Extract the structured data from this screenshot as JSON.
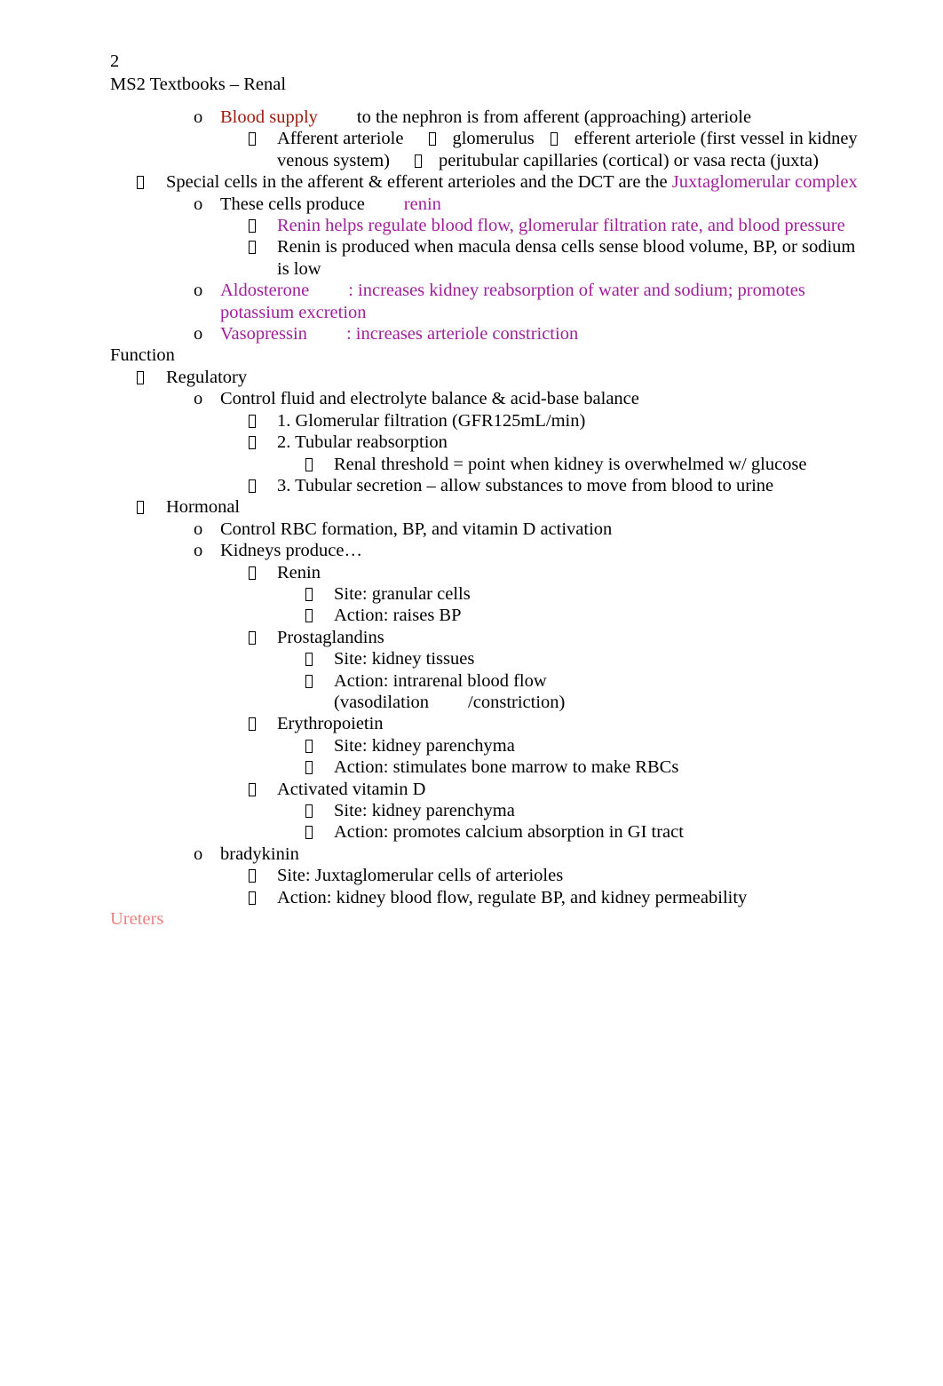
{
  "header": {
    "page_number": "2",
    "title": "MS2 Textbooks – Renal"
  },
  "colors": {
    "heading_red": "#9C1A10",
    "purple": "#A0209B",
    "salmon": "#F08080",
    "black": "#000000"
  },
  "markers": {
    "circle": "o",
    "box": "□"
  },
  "outline": {
    "blood_supply": {
      "label": "Blood supply",
      "rest": "to the nephron is from afferent (approaching) arteriole"
    },
    "afferent_chain": {
      "part1": "Afferent arteriole",
      "part2": "glomerulus",
      "part3": "efferent arteriole (first vessel in kidney venous system)",
      "part4": "peritubular capillaries (cortical) or vasa recta (juxta)"
    },
    "special_cells": {
      "text": "Special cells in the afferent & efferent arterioles and the DCT are the",
      "highlight": "Juxtaglomerular complex"
    },
    "these_cells_produce": {
      "text": "These cells produce",
      "highlight": "renin"
    },
    "renin_helps": "Renin helps regulate blood flow, glomerular filtration rate, and blood pressure",
    "renin_produced": "Renin is produced when macula densa cells sense blood volume, BP, or sodium is low",
    "aldosterone": {
      "term": "Aldosterone",
      "definition": ": increases kidney reabsorption of water and sodium; promotes potassium excretion"
    },
    "vasopressin": {
      "term": "Vasopressin",
      "definition": ":  increases arteriole constriction"
    },
    "function_heading": "Function",
    "regulatory": "Regulatory",
    "control_fluid": "Control fluid and electrolyte balance & acid-base balance",
    "step1": "1. Glomerular filtration (GFR125mL/min)",
    "step2": "2. Tubular reabsorption",
    "renal_threshold": "Renal threshold = point when kidney is overwhelmed w/ glucose",
    "step3": "3. Tubular secretion – allow substances to move from blood to urine",
    "hormonal": "Hormonal",
    "control_rbc": "Control RBC formation, BP, and vitamin D activation",
    "kidneys_produce": "Kidneys produce…",
    "renin": {
      "name": "Renin",
      "site": "Site: granular cells",
      "action": "Action: raises BP"
    },
    "prostaglandins": {
      "name": "Prostaglandins",
      "site": "Site: kidney tissues",
      "action_pre": "Action: intrarenal blood flow",
      "action_paren_open": "(vasodilation",
      "action_paren_close": "/constriction)"
    },
    "erythropoietin": {
      "name": "Erythropoietin",
      "site": "Site: kidney parenchyma",
      "action": "Action: stimulates bone marrow to make RBCs"
    },
    "activated_vitamin_d": {
      "name": "Activated vitamin D",
      "site": "Site: kidney parenchyma",
      "action": "Action: promotes calcium absorption in GI tract"
    },
    "bradykinin": {
      "name": "bradykinin",
      "site": "Site: Juxtaglomerular cells of arterioles",
      "action": "Action: kidney blood flow, regulate BP, and kidney permeability"
    },
    "ureters_heading": "Ureters"
  }
}
